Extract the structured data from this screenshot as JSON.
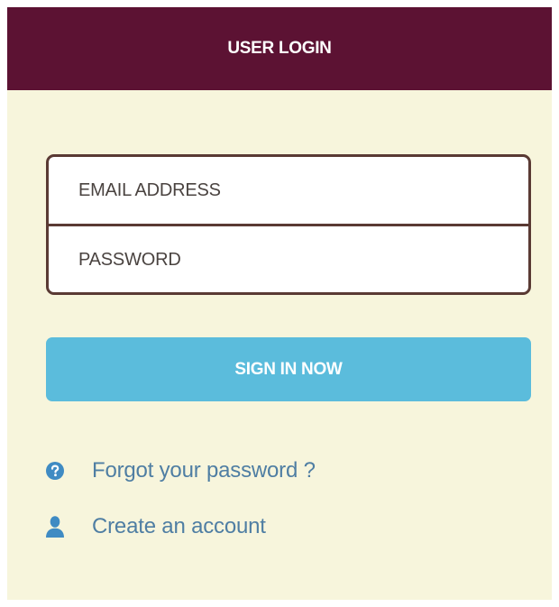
{
  "header": {
    "title": "USER LOGIN"
  },
  "form": {
    "email_placeholder": "EMAIL ADDRESS",
    "password_placeholder": "PASSWORD",
    "submit_label": "SIGN IN NOW"
  },
  "links": {
    "forgot_password": "Forgot your password ?",
    "create_account": "Create an account"
  },
  "icons": {
    "forgot": "question-circle-icon",
    "create": "user-icon"
  },
  "colors": {
    "header_bg": "#5c1233",
    "panel_bg": "#f7f5dc",
    "button_bg": "#5bbcdc",
    "link": "#4f7ea3",
    "field_border": "#5a3a34"
  }
}
